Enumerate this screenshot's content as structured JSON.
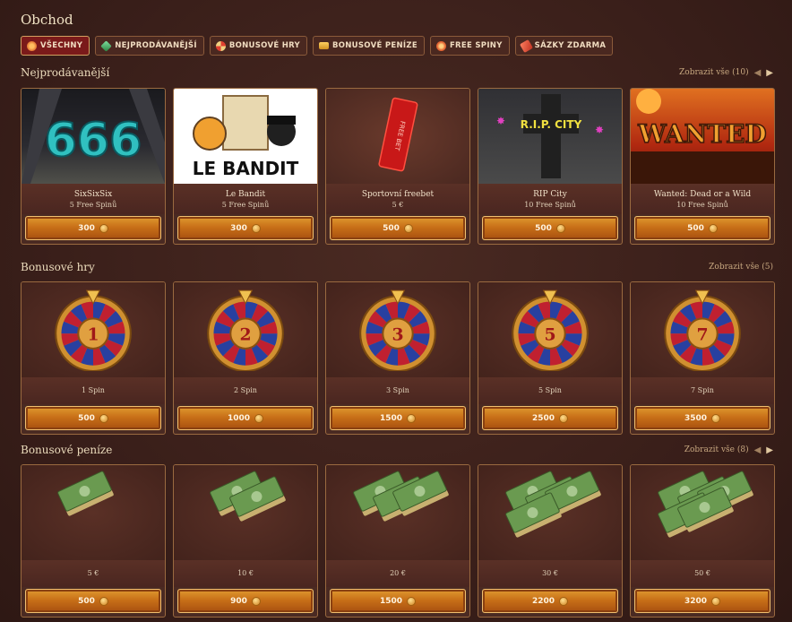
{
  "page": {
    "title": "Obchod"
  },
  "filters": [
    {
      "label": "VŠECHNY",
      "icon": "wheel-icon",
      "color": "#e07030",
      "active": true
    },
    {
      "label": "NEJPRODÁVANĚJŠÍ",
      "icon": "gem-icon",
      "color": "#40a060",
      "active": false
    },
    {
      "label": "BONUSOVÉ HRY",
      "icon": "wheel-icon",
      "color": "#e04030",
      "active": false
    },
    {
      "label": "BONUSOVÉ PENÍZE",
      "icon": "cash-icon",
      "color": "#e0a030",
      "active": false
    },
    {
      "label": "FREE SPINY",
      "icon": "spin-icon",
      "color": "#e06030",
      "active": false
    },
    {
      "label": "SÁZKY ZDARMA",
      "icon": "ticket-icon",
      "color": "#d04030",
      "active": false
    }
  ],
  "sections": [
    {
      "title": "Nejprodávanější",
      "view_all": "Zobrazit vše (10)",
      "has_arrows": true,
      "items": [
        {
          "name": "SixSixSix",
          "sub": "5 Free Spinů",
          "price": "300",
          "image": "sixsixsix-art",
          "logo_text": "666"
        },
        {
          "name": "Le Bandit",
          "sub": "5 Free Spinů",
          "price": "300",
          "image": "le-bandit-art",
          "logo_text": "LE BANDIT"
        },
        {
          "name": "Sportovní freebet",
          "sub": "5 €",
          "price": "500",
          "image": "freebet-ticket-art",
          "logo_text": "FREE BET"
        },
        {
          "name": "RIP City",
          "sub": "10 Free Spinů",
          "price": "500",
          "image": "rip-city-art",
          "logo_text": "R.I.P. CITY"
        },
        {
          "name": "Wanted: Dead or a Wild",
          "sub": "10 Free Spinů",
          "price": "500",
          "image": "wanted-art",
          "logo_text": "WANTED"
        }
      ]
    },
    {
      "title": "Bonusové hry",
      "view_all": "Zobrazit vše (5)",
      "has_arrows": false,
      "items": [
        {
          "name": "1 Spin",
          "price": "500",
          "wheel_number": "1"
        },
        {
          "name": "2 Spin",
          "price": "1000",
          "wheel_number": "2"
        },
        {
          "name": "3 Spin",
          "price": "1500",
          "wheel_number": "3"
        },
        {
          "name": "5 Spin",
          "price": "2500",
          "wheel_number": "5"
        },
        {
          "name": "7 Spin",
          "price": "3500",
          "wheel_number": "7"
        }
      ]
    },
    {
      "title": "Bonusové peníze",
      "view_all": "Zobrazit vše (8)",
      "has_arrows": true,
      "items": [
        {
          "name": "5 €",
          "price": "500",
          "stacks": 1
        },
        {
          "name": "10 €",
          "price": "900",
          "stacks": 2
        },
        {
          "name": "20 €",
          "price": "1500",
          "stacks": 3
        },
        {
          "name": "30 €",
          "price": "2200",
          "stacks": 4
        },
        {
          "name": "50 €",
          "price": "3200",
          "stacks": 5
        }
      ]
    }
  ]
}
